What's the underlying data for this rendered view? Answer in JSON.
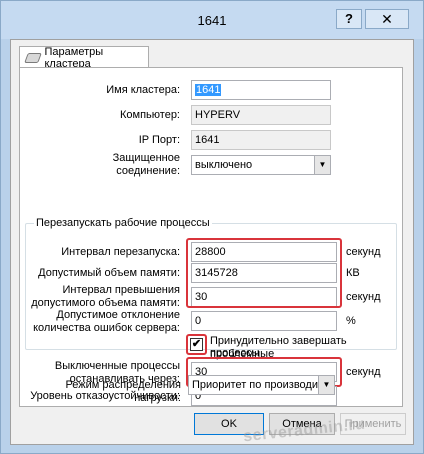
{
  "window": {
    "title": "1641",
    "help_glyph": "?",
    "close_glyph": "✕"
  },
  "tab": {
    "label": "Параметры кластера"
  },
  "fields": {
    "cluster_name": {
      "label": "Имя кластера:",
      "value": "1641"
    },
    "computer": {
      "label": "Компьютер:",
      "value": "HYPERV"
    },
    "ip_port": {
      "label": "IP Порт:",
      "value": "1641"
    },
    "secure": {
      "label_line1": "Защищенное",
      "label_line2": "соединение:",
      "value": "выключено"
    }
  },
  "restart_group": {
    "title": "Перезапускать рабочие процессы",
    "interval": {
      "label": "Интервал перезапуска:",
      "value": "28800",
      "unit": "секунд"
    },
    "memory": {
      "label": "Допустимый объем памяти:",
      "value": "3145728",
      "unit": "КВ"
    },
    "mem_exceed": {
      "label_line1": "Интервал превышения",
      "label_line2": "допустимого объема памяти:",
      "value": "30",
      "unit": "секунд"
    },
    "error_dev": {
      "label_line1": "Допустимое отклонение",
      "label_line2": "количества ошибок сервера:",
      "value": "0",
      "unit": "%"
    },
    "force_kill": {
      "label_line1": "Принудительно завершать проблемные",
      "label_line2": "процессы",
      "checked": true
    }
  },
  "stop_procs": {
    "label_line1": "Выключенные процессы",
    "label_line2": "останавливать через:",
    "value": "30",
    "unit": "секунд"
  },
  "fault_level": {
    "label": "Уровень отказоустойчивости:",
    "value": "0"
  },
  "load_mode": {
    "label": "Режим распределения нагрузки:",
    "value": "Приоритет по производител"
  },
  "buttons": {
    "ok": "OK",
    "cancel": "Отмена",
    "apply": "Применить"
  },
  "watermark": "serveradmin.ru",
  "colors": {
    "highlight_border": "#d9343b",
    "selection": "#3399ff"
  }
}
